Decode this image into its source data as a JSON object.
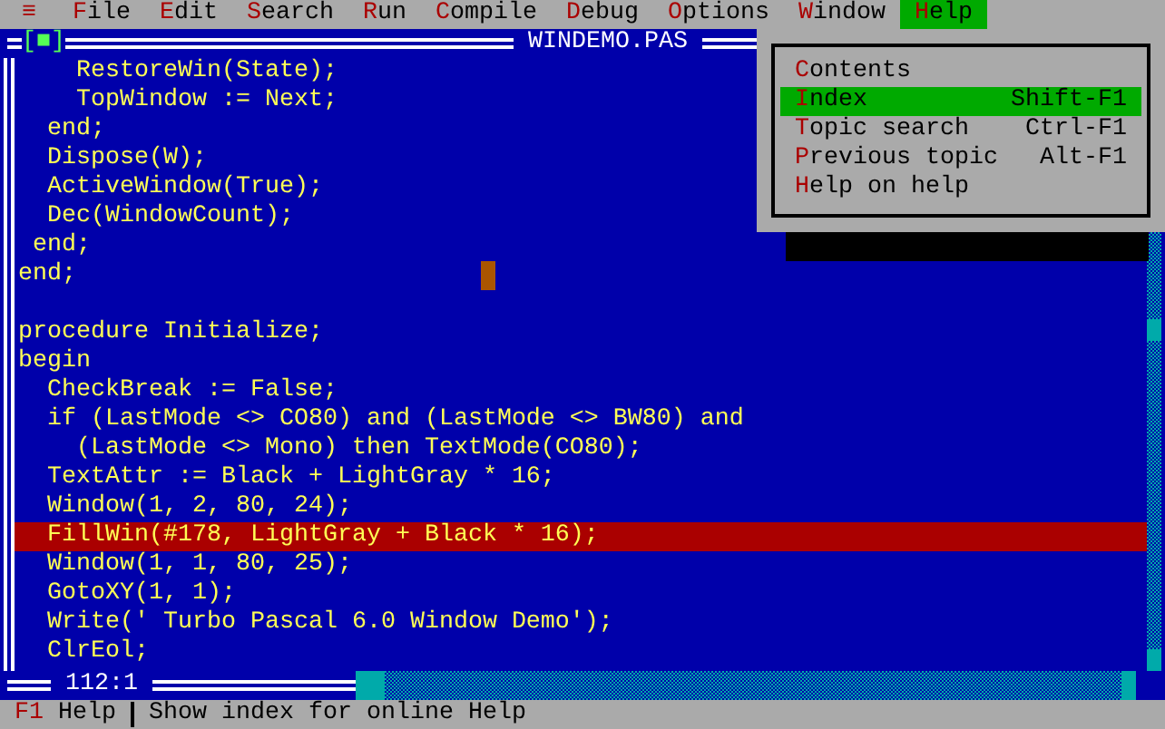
{
  "menu_bar": [
    {
      "kind": "system",
      "key": "≡",
      "selected": false
    },
    {
      "kind": "menu",
      "key": "F",
      "rest": "ile",
      "selected": false
    },
    {
      "kind": "menu",
      "key": "E",
      "rest": "dit",
      "selected": false
    },
    {
      "kind": "menu",
      "key": "S",
      "rest": "earch",
      "selected": false
    },
    {
      "kind": "menu",
      "key": "R",
      "rest": "un",
      "selected": false
    },
    {
      "kind": "menu",
      "key": "C",
      "rest": "ompile",
      "selected": false
    },
    {
      "kind": "menu",
      "key": "D",
      "rest": "ebug",
      "selected": false
    },
    {
      "kind": "menu",
      "key": "O",
      "rest": "ptions",
      "selected": false
    },
    {
      "kind": "menu",
      "key": "W",
      "rest": "indow",
      "selected": false
    },
    {
      "kind": "menu",
      "key": "H",
      "rest": "elp",
      "selected": true
    }
  ],
  "window": {
    "close_box": "[■]",
    "title": "WINDEMO.PAS",
    "position": "112:1"
  },
  "lines": [
    {
      "text": "    RestoreWin(State);",
      "selected": false
    },
    {
      "text": "    TopWindow := Next;",
      "selected": false
    },
    {
      "text": "  end;",
      "selected": false
    },
    {
      "text": "  Dispose(W);",
      "selected": false
    },
    {
      "text": "  ActiveWindow(True);",
      "selected": false
    },
    {
      "text": "  Dec(WindowCount);",
      "selected": false
    },
    {
      "text": " end;",
      "selected": false
    },
    {
      "text": "end;",
      "selected": false,
      "cursor": true
    },
    {
      "selected": false
    },
    {
      "text": "procedure Initialize;",
      "selected": false
    },
    {
      "text": "begin",
      "selected": false
    },
    {
      "text": "  CheckBreak := False;",
      "selected": false
    },
    {
      "text": "  if (LastMode <> CO80) and (LastMode <> BW80) and",
      "selected": false
    },
    {
      "text": "    (LastMode <> Mono) then TextMode(CO80);",
      "selected": false
    },
    {
      "text": "  TextAttr := Black + LightGray * 16;",
      "selected": false
    },
    {
      "text": "  Window(1, 2, 80, 24);",
      "selected": false
    },
    {
      "text": "  FillWin(#178, LightGray + Black * 16);",
      "selected": true
    },
    {
      "text": "  Window(1, 1, 80, 25);",
      "selected": false
    },
    {
      "text": "  GotoXY(1, 1);",
      "selected": false
    },
    {
      "text": "  Write(' Turbo Pascal 6.0 Window Demo');",
      "selected": false
    },
    {
      "text": "  ClrEol;",
      "selected": false
    }
  ],
  "help_menu": [
    {
      "key": "C",
      "rest": "ontents",
      "selected": false
    },
    {
      "key": "I",
      "rest": "ndex",
      "shortcut": "Shift-F1",
      "selected": true
    },
    {
      "key": "T",
      "rest": "opic search",
      "shortcut": "Ctrl-F1",
      "selected": false
    },
    {
      "key": "P",
      "rest": "revious topic",
      "shortcut": "Alt-F1",
      "selected": false
    },
    {
      "key": "H",
      "rest": "elp on help",
      "selected": false
    }
  ],
  "status_bar": {
    "key": "F1",
    "label": "Help",
    "message": "Show index for online Help"
  }
}
